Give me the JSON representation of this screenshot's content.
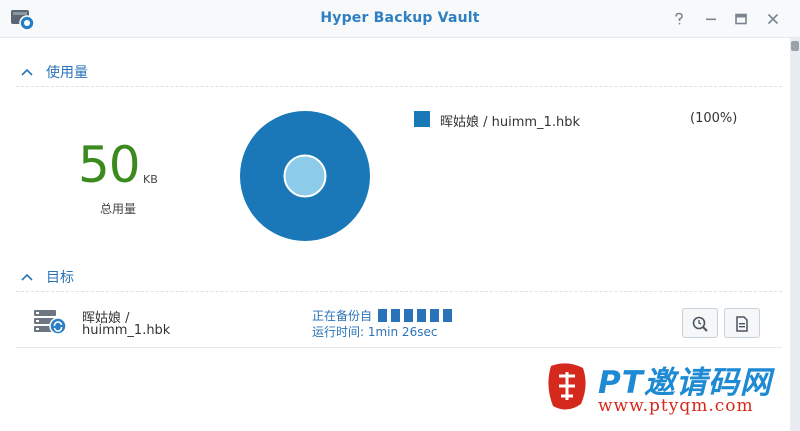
{
  "window": {
    "title": "Hyper Backup Vault"
  },
  "usage": {
    "section_label": "使用量",
    "total_value": "50",
    "total_unit": "KB",
    "total_label": "总用量",
    "legend": [
      {
        "name": "晖姑娘 / huimm_1.hbk",
        "percent": "(100%)",
        "share": 1.0,
        "color": "#1a78b9"
      }
    ]
  },
  "target": {
    "section_label": "目标",
    "name_line1": "晖姑娘 /",
    "name_line2": "huimm_1.hbk",
    "status_text": "正在备份自",
    "runtime_text": "运行时间: 1min 26sec"
  },
  "watermark": {
    "brand": "PT邀请码网",
    "url": "www.ptyqm.com",
    "logo_char": "激"
  },
  "colors": {
    "accent": "#2b73b8",
    "usage_number": "#3a8a1e",
    "donut": "#1a78b9",
    "donut_center": "#8ccbea"
  },
  "icons": {
    "help": "question-mark-icon",
    "minimize": "minimize-icon",
    "maximize": "maximize-icon",
    "close": "close-icon",
    "browse": "search-clock-icon",
    "log": "document-icon"
  }
}
